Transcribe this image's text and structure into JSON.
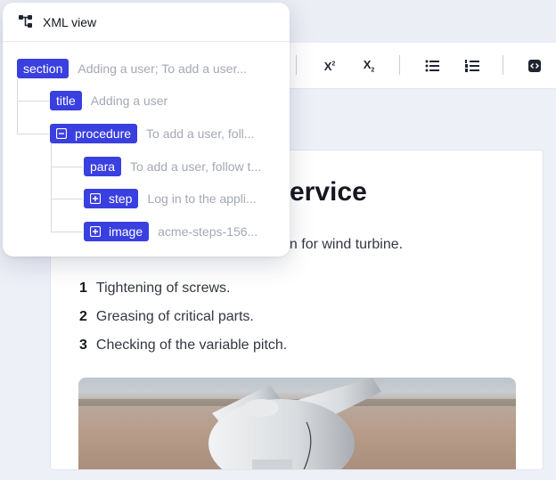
{
  "toolbar": {
    "superscript": {
      "label": "X",
      "mark": "2"
    },
    "subscript": {
      "label": "X",
      "mark": "2"
    }
  },
  "xml_view": {
    "title": "XML view",
    "nodes": [
      {
        "tag": "section",
        "preview": "Adding a user; To add a user..."
      },
      {
        "tag": "title",
        "preview": "Adding a user"
      },
      {
        "tag": "procedure",
        "preview": "To add a user, foll..."
      },
      {
        "tag": "para",
        "preview": "To add a user, follow t..."
      },
      {
        "tag": "step",
        "preview": "Log in to the appli..."
      },
      {
        "tag": "image",
        "preview": "acme-steps-156..."
      }
    ]
  },
  "document": {
    "title_visible": "ervice",
    "intro_visible": "an for wind turbine.",
    "list": [
      {
        "num": "1",
        "text": "Tightening of screws."
      },
      {
        "num": "2",
        "text": "Greasing of critical parts."
      },
      {
        "num": "3",
        "text": "Checking of the variable pitch."
      }
    ]
  }
}
